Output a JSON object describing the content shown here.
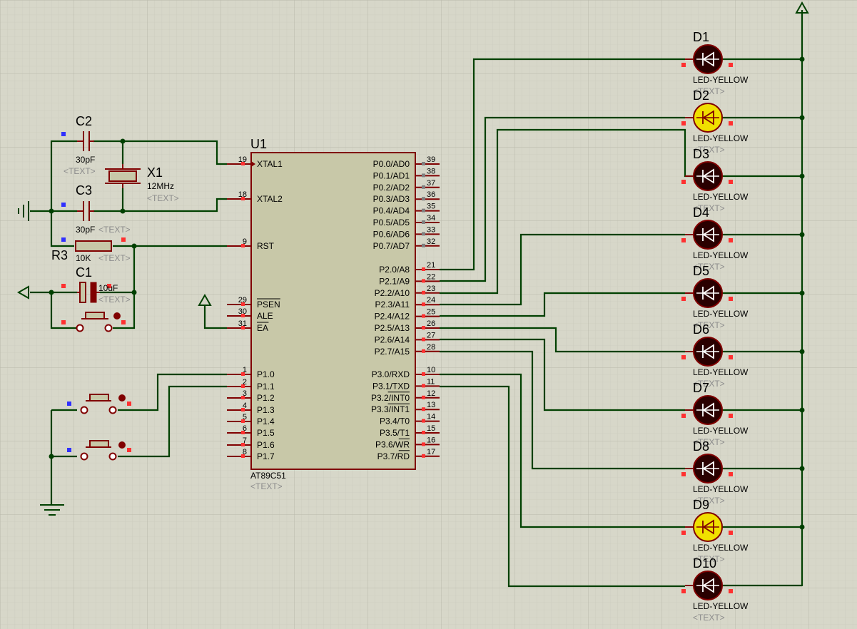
{
  "mcu": {
    "ref": "U1",
    "part": "AT89C51",
    "text": "<TEXT>",
    "left_pins": [
      {
        "num": "19",
        "name": "XTAL1"
      },
      {
        "num": "18",
        "name": "XTAL2"
      },
      {
        "num": "9",
        "name": "RST"
      },
      {
        "num": "29",
        "name": "PSEN"
      },
      {
        "num": "30",
        "name": "ALE"
      },
      {
        "num": "31",
        "name": "EA"
      },
      {
        "num": "1",
        "name": "P1.0"
      },
      {
        "num": "2",
        "name": "P1.1"
      },
      {
        "num": "3",
        "name": "P1.2"
      },
      {
        "num": "4",
        "name": "P1.3"
      },
      {
        "num": "5",
        "name": "P1.4"
      },
      {
        "num": "6",
        "name": "P1.5"
      },
      {
        "num": "7",
        "name": "P1.6"
      },
      {
        "num": "8",
        "name": "P1.7"
      }
    ],
    "right_pins": [
      {
        "num": "39",
        "name": "P0.0/AD0"
      },
      {
        "num": "38",
        "name": "P0.1/AD1"
      },
      {
        "num": "37",
        "name": "P0.2/AD2"
      },
      {
        "num": "36",
        "name": "P0.3/AD3"
      },
      {
        "num": "35",
        "name": "P0.4/AD4"
      },
      {
        "num": "34",
        "name": "P0.5/AD5"
      },
      {
        "num": "33",
        "name": "P0.6/AD6"
      },
      {
        "num": "32",
        "name": "P0.7/AD7"
      },
      {
        "num": "21",
        "name": "P2.0/A8"
      },
      {
        "num": "22",
        "name": "P2.1/A9"
      },
      {
        "num": "23",
        "name": "P2.2/A10"
      },
      {
        "num": "24",
        "name": "P2.3/A11"
      },
      {
        "num": "25",
        "name": "P2.4/A12"
      },
      {
        "num": "26",
        "name": "P2.5/A13"
      },
      {
        "num": "27",
        "name": "P2.6/A14"
      },
      {
        "num": "28",
        "name": "P2.7/A15"
      },
      {
        "num": "10",
        "name": "P3.0/RXD"
      },
      {
        "num": "11",
        "name": "P3.1/TXD"
      },
      {
        "num": "12",
        "name": "P3.2/INT0"
      },
      {
        "num": "13",
        "name": "P3.3/INT1"
      },
      {
        "num": "14",
        "name": "P3.4/T0"
      },
      {
        "num": "15",
        "name": "P3.5/T1"
      },
      {
        "num": "16",
        "name": "P3.6/WR"
      },
      {
        "num": "17",
        "name": "P3.7/RD"
      }
    ]
  },
  "components": {
    "c2": {
      "ref": "C2",
      "value": "30pF",
      "text": "<TEXT>"
    },
    "c3": {
      "ref": "C3",
      "value": "30pF",
      "text": "<TEXT>"
    },
    "x1": {
      "ref": "X1",
      "value": "12MHz",
      "text": "<TEXT>"
    },
    "r3": {
      "ref": "R3",
      "value": "10K",
      "text": "<TEXT>"
    },
    "c1": {
      "ref": "C1",
      "value": "10uF",
      "text": "<TEXT>"
    }
  },
  "leds": [
    {
      "ref": "D1",
      "part": "LED-YELLOW",
      "text": "<TEXT>",
      "lit": false
    },
    {
      "ref": "D2",
      "part": "LED-YELLOW",
      "text": "<TEXT>",
      "lit": true
    },
    {
      "ref": "D3",
      "part": "LED-YELLOW",
      "text": "<TEXT>",
      "lit": false
    },
    {
      "ref": "D4",
      "part": "LED-YELLOW",
      "text": "<TEXT>",
      "lit": false
    },
    {
      "ref": "D5",
      "part": "LED-YELLOW",
      "text": "<TEXT>",
      "lit": false
    },
    {
      "ref": "D6",
      "part": "LED-YELLOW",
      "text": "<TEXT>",
      "lit": false
    },
    {
      "ref": "D7",
      "part": "LED-YELLOW",
      "text": "<TEXT>",
      "lit": false
    },
    {
      "ref": "D8",
      "part": "LED-YELLOW",
      "text": "<TEXT>",
      "lit": false
    },
    {
      "ref": "D9",
      "part": "LED-YELLOW",
      "text": "<TEXT>",
      "lit": true
    },
    {
      "ref": "D10",
      "part": "LED-YELLOW",
      "text": "<TEXT>",
      "lit": false
    }
  ],
  "colors": {
    "background": "#d7d7c9",
    "grid": "#c4c4b6",
    "wire": "#004000",
    "component_outline": "#800000",
    "chip_fill": "#c8c8a8",
    "led_off": "#2a0000",
    "led_on": "#f0e000",
    "pin_marker_red": "#ff3030",
    "pin_marker_blue": "#3030ff"
  }
}
